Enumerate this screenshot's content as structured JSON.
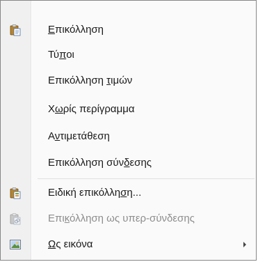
{
  "menu": {
    "items": [
      {
        "pre": "",
        "ul": "Ε",
        "post": "πικόλληση",
        "icon": "paste-icon",
        "enabled": true
      },
      {
        "pre": "Τύ",
        "ul": "π",
        "post": "οι",
        "icon": "",
        "enabled": true
      },
      {
        "pre": "Επικόλληση ",
        "ul": "τ",
        "post": "ιμών",
        "icon": "",
        "enabled": true
      },
      {
        "pre": "Χ",
        "ul": "ω",
        "post": "ρίς περίγραμμα",
        "icon": "",
        "enabled": true
      },
      {
        "pre": "Α",
        "ul": "ν",
        "post": "τιμετάθεση",
        "icon": "",
        "enabled": true
      },
      {
        "pre": "Επικόλληση σύν",
        "ul": "δ",
        "post": "εσης",
        "icon": "",
        "enabled": true
      },
      {
        "pre": "Ειδική επικόλλη",
        "ul": "σ",
        "post": "η...",
        "icon": "paste-special-icon",
        "enabled": true
      },
      {
        "pre": "Επι",
        "ul": "κ",
        "post": "όλληση ως υπερ-σύνδεσης",
        "icon": "paste-hyperlink-icon",
        "enabled": false
      },
      {
        "pre": "",
        "ul": "Ω",
        "post": "ς εικόνα",
        "icon": "picture-icon",
        "enabled": true,
        "submenu": true
      }
    ]
  }
}
